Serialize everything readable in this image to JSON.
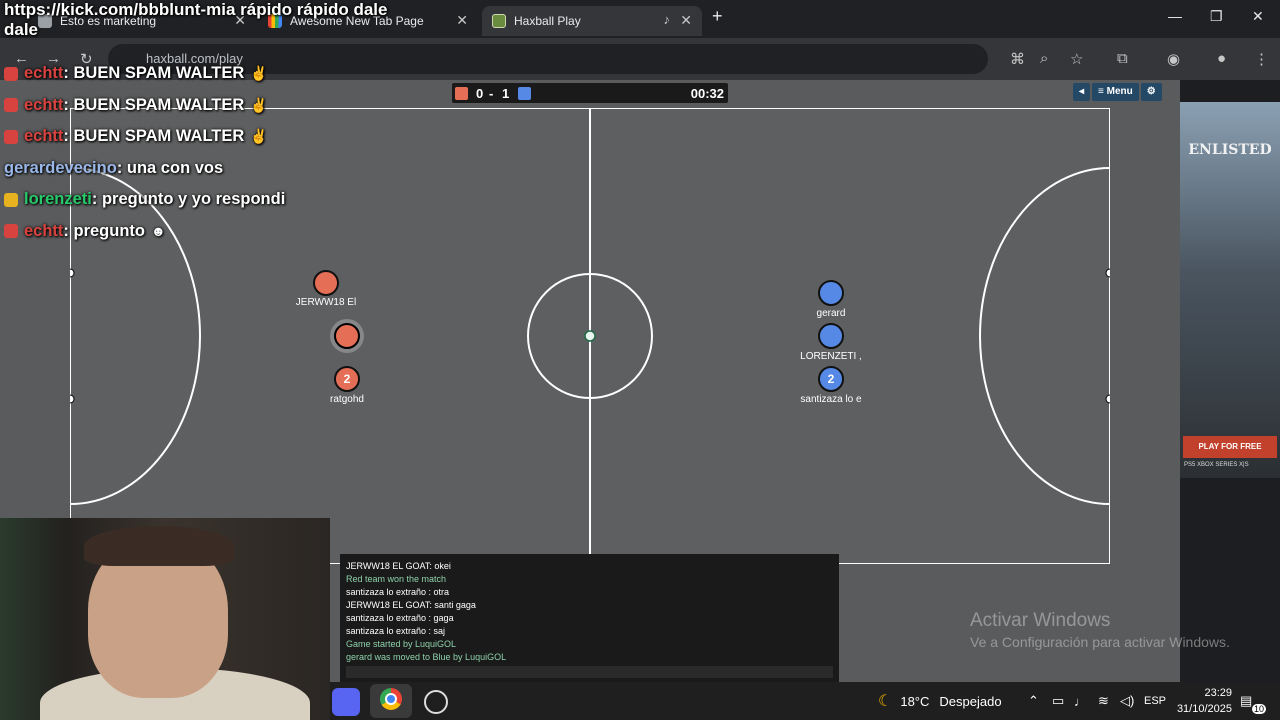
{
  "browser": {
    "tabs": [
      {
        "label": "Esto es marketing",
        "active": false
      },
      {
        "label": "Awesome New Tab Page",
        "active": false
      },
      {
        "label": "Haxball Play",
        "active": true
      }
    ],
    "url": "haxball.com/play"
  },
  "stream": {
    "title": "https://kick.com/bbblunt-mia rápido rápido dale dale",
    "chat": [
      {
        "user": "echtt",
        "message": ": BUEN SPAM WALTER",
        "user_color": "#d8433f",
        "badge_color": "#d8433f"
      },
      {
        "user": "echtt",
        "message": ": BUEN SPAM WALTER",
        "user_color": "#d8433f",
        "badge_color": "#d8433f"
      },
      {
        "user": "echtt",
        "message": ": BUEN SPAM WALTER",
        "user_color": "#d8433f",
        "badge_color": "#d8433f"
      },
      {
        "user": "gerardevecino",
        "message": ": una con vos",
        "user_color": "#9ab7e8",
        "badge_color": ""
      },
      {
        "user": "lorenzeti",
        "message": ": pregunto y yo respondi",
        "user_color": "#27c96a",
        "badge_color": "#e6b21f"
      },
      {
        "user": "echtt",
        "message": ": pregunto",
        "user_color": "#d8433f",
        "badge_color": "#d8433f"
      }
    ]
  },
  "game": {
    "score_red": "0",
    "score_sep": "-",
    "score_blue": "1",
    "timer": "00:32",
    "menu_label": "≡ Menu",
    "red_color": "#e56e56",
    "blue_color": "#5689e5",
    "players": [
      {
        "name": "JERWW18 El",
        "team": "red",
        "avatar": ""
      },
      {
        "name": "",
        "team": "red",
        "avatar": ""
      },
      {
        "name": "ratgohd",
        "team": "red",
        "avatar": "2"
      },
      {
        "name": "gerard",
        "team": "blue",
        "avatar": ""
      },
      {
        "name": "LORENZETI ,",
        "team": "blue",
        "avatar": ""
      },
      {
        "name": "santizaza lo e",
        "team": "blue",
        "avatar": "2"
      }
    ],
    "chat": [
      {
        "text": "JERWW18 EL GOAT: okei",
        "system": false
      },
      {
        "text": "Red team won the match",
        "system": true
      },
      {
        "text": "santizaza lo extraño : otra",
        "system": false
      },
      {
        "text": "JERWW18 EL GOAT: santi gaga",
        "system": false
      },
      {
        "text": "santizaza lo extraño : gaga",
        "system": false
      },
      {
        "text": "santizaza lo extraño : saj",
        "system": false
      },
      {
        "text": "Game started by LuquiGOL",
        "system": true
      },
      {
        "text": "gerard was moved to Blue by LuquiGOL",
        "system": true
      }
    ]
  },
  "ad": {
    "title": "ENLISTED",
    "cta": "PLAY FOR FREE",
    "platforms": "PS5   XBOX SERIES X|S"
  },
  "watermark": {
    "line1": "Activar Windows",
    "line2": "Ve a Configuración para activar Windows."
  },
  "taskbar": {
    "weather_temp": "18°C",
    "weather_desc": "Despejado",
    "language": "ESP",
    "time": "23:29",
    "date": "31/10/2025",
    "notifications": "10"
  }
}
